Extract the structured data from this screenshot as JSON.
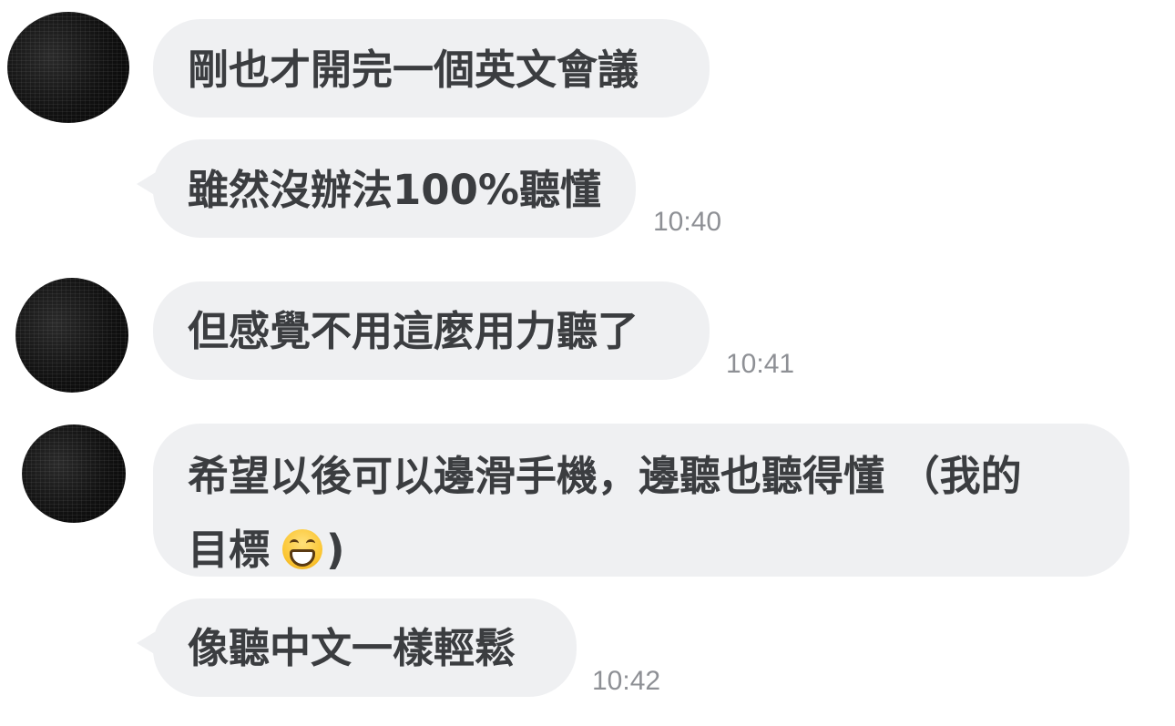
{
  "messages": [
    {
      "id": 1,
      "text": "剛也才開完一個英文會議",
      "time": ""
    },
    {
      "id": 2,
      "text": "雖然沒辦法100%聽懂",
      "time": "10:40"
    },
    {
      "id": 3,
      "text": "但感覺不用這麼用力聽了",
      "time": "10:41"
    },
    {
      "id": 4,
      "lines": [
        "希望以後可以邊滑手機，邊聽也聽得懂 （我的",
        "目標"
      ],
      "emoji": "grinning-face-emoji",
      "suffix": ")",
      "time": ""
    },
    {
      "id": 5,
      "text": "像聽中文一樣輕鬆",
      "time": "10:42"
    }
  ],
  "colors": {
    "bubble": "#eff0f2",
    "text": "#3b3d40",
    "timestamp": "#8e9095",
    "background": "#ffffff"
  },
  "icons": {
    "avatar": "sender-avatar",
    "emoji": "grinning-face-emoji"
  }
}
